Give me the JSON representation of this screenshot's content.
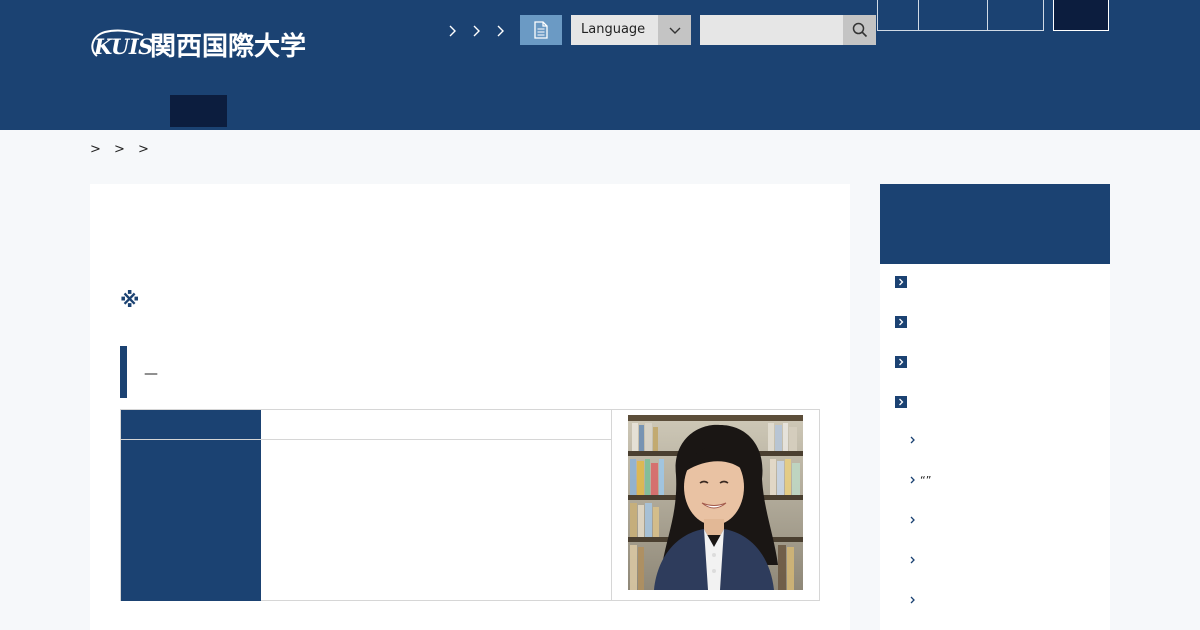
{
  "header": {
    "logo": {
      "mark": "KUIS",
      "name": "関西国際大学"
    },
    "language": {
      "label": "Language"
    },
    "search": {
      "placeholder": "",
      "value": ""
    },
    "util_links": [
      "",
      "",
      ""
    ]
  },
  "breadcrumb": [
    ">",
    ">",
    ">"
  ],
  "main": {
    "note_mark": "※",
    "section_title": "—"
  },
  "sidebar": {
    "items": [
      "",
      "",
      "",
      ""
    ],
    "sub_items": [
      "",
      "“”",
      "",
      "",
      ""
    ]
  },
  "colors": {
    "primary": "#1b4272",
    "dark": "#0c1d3e",
    "doc_button": "#6b9ac4",
    "page_bg": "#f6f8fa"
  },
  "icons": {
    "doc": "document-icon",
    "lang": "chevron-down-icon",
    "search": "search-icon",
    "nav": "chevron-right-icon"
  }
}
